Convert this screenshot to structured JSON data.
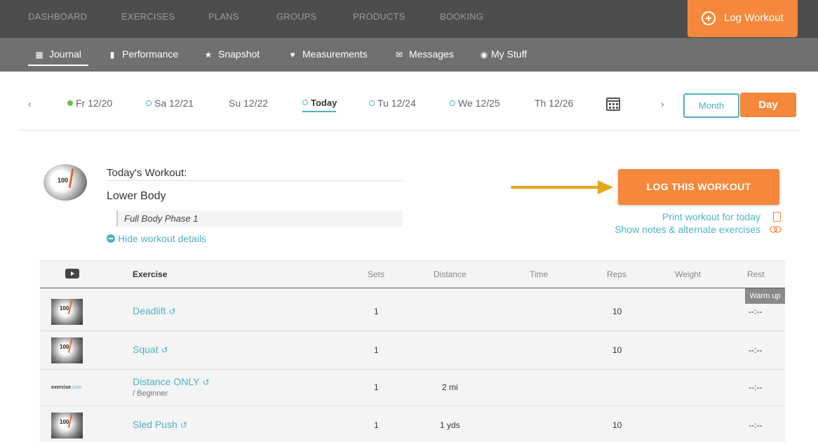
{
  "topnav": {
    "items": [
      "DASHBOARD",
      "EXERCISES",
      "PLANS",
      "GROUPS",
      "PRODUCTS",
      "BOOKING"
    ],
    "log_workout": "Log Workout"
  },
  "subnav": {
    "items": [
      {
        "label": "Journal",
        "icon": "calendar-check-icon",
        "active": true
      },
      {
        "label": "Performance",
        "icon": "bar-chart-icon"
      },
      {
        "label": "Snapshot",
        "icon": "star-icon"
      },
      {
        "label": "Measurements",
        "icon": "heartbeat-icon"
      },
      {
        "label": "Messages",
        "icon": "envelope-icon"
      },
      {
        "label": "My Stuff",
        "icon": "user-circle-icon"
      }
    ]
  },
  "dates": {
    "prev": "‹",
    "next": "›",
    "items": [
      {
        "label": "Fr 12/20",
        "marker": "filled"
      },
      {
        "label": "Sa 12/21",
        "marker": "open"
      },
      {
        "label": "Su 12/22",
        "marker": "none"
      },
      {
        "label": "Today",
        "marker": "open",
        "active": true
      },
      {
        "label": "Tu 12/24",
        "marker": "open"
      },
      {
        "label": "We 12/25",
        "marker": "open"
      },
      {
        "label": "Th 12/26",
        "marker": "none"
      }
    ],
    "month_label": "Month",
    "day_label": "Day"
  },
  "workout": {
    "todays_label": "Today's Workout:",
    "name": "Lower Body",
    "plan": "Full Body Phase 1",
    "hide_details": "Hide workout details",
    "log_this": "LOG THIS WORKOUT",
    "print_link": "Print workout for today",
    "notes_link": "Show notes & alternate exercises",
    "avatar_number": "100"
  },
  "table": {
    "headers": {
      "exercise": "Exercise",
      "sets": "Sets",
      "distance": "Distance",
      "time": "Time",
      "reps": "Reps",
      "weight": "Weight",
      "rest": "Rest"
    },
    "warmup": "Warm up",
    "rows": [
      {
        "name": "Deadlift",
        "sub": "",
        "sets": "1",
        "distance": "",
        "reps": "10",
        "rest": "--:--",
        "thumb": "scale"
      },
      {
        "name": "Squat",
        "sub": "",
        "sets": "1",
        "distance": "",
        "reps": "10",
        "rest": "--:--",
        "thumb": "scale"
      },
      {
        "name": "Distance ONLY",
        "sub": "/ Beginner",
        "sets": "1",
        "distance": "2 mi",
        "reps": "",
        "rest": "--:--",
        "thumb": "logo",
        "logo_a": "exercise",
        "logo_b": ".com"
      },
      {
        "name": "Sled Push",
        "sub": "",
        "sets": "1",
        "distance": "1 yds",
        "reps": "10",
        "rest": "--:--",
        "thumb": "scale"
      }
    ]
  },
  "colors": {
    "accent": "#f5883a",
    "link": "#4fb2c4",
    "topnav_bg": "#4d4d4d",
    "subnav_bg": "#707070"
  }
}
